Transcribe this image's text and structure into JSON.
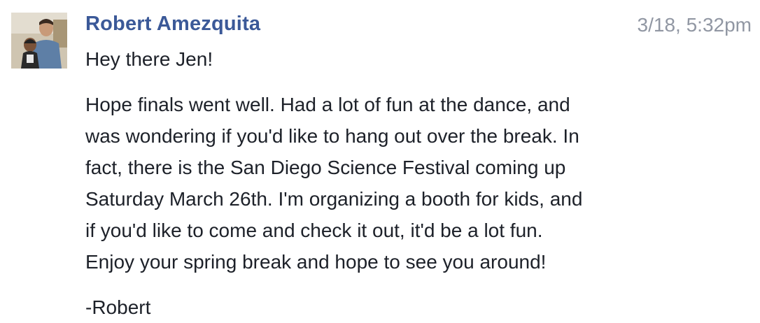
{
  "message": {
    "sender_name": "Robert Amezquita",
    "timestamp": "3/18, 5:32pm",
    "avatar": "profile-photo",
    "greeting": "Hey there Jen!",
    "body_lines": [
      "Hope finals went well. Had a lot of fun at the dance, and",
      "was wondering if you'd like to hang out over the break. In",
      "fact, there is the San Diego Science Festival coming up",
      "Saturday March 26th. I'm organizing a booth for kids, and",
      "if you'd like to come and check it out, it'd be a lot fun.",
      "Enjoy your spring break and hope to see you around!"
    ],
    "signature": "-Robert"
  },
  "colors": {
    "sender": "#3b5998",
    "timestamp": "#9197a3",
    "text": "#1d2129"
  }
}
